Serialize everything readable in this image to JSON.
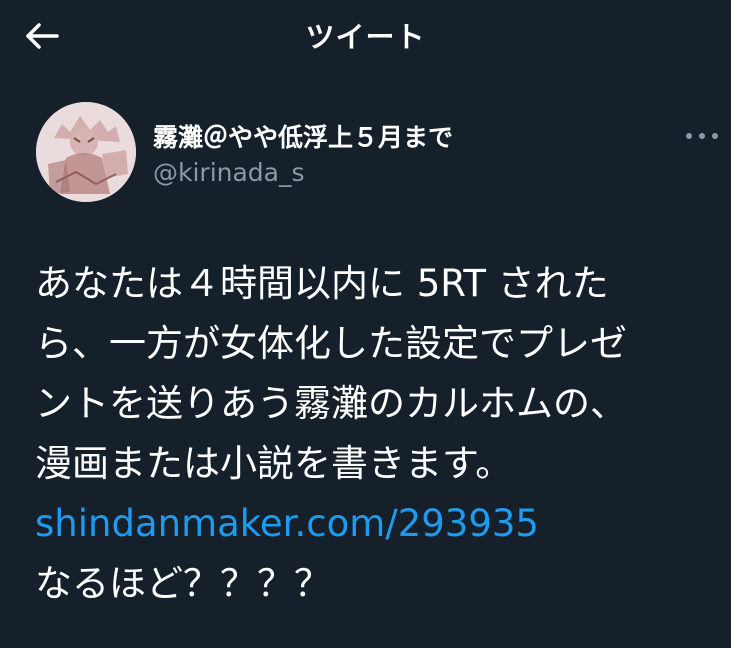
{
  "header": {
    "title": "ツイート",
    "back_icon": "arrow-left-icon"
  },
  "tweet": {
    "author": {
      "display_name": "霧灘＠やや低浮上５月まで",
      "handle": "@kirinada_s",
      "avatar": "avatar-image"
    },
    "more_icon": "more-horizontal-icon",
    "text_lines": [
      "あなたは４時間以内に 5RT された",
      "ら、一方が女体化した設定でプレゼ",
      "ントを送りあう霧灘のカルホムの、",
      "漫画または小説を書きます。"
    ],
    "link": "shindanmaker.com/293935",
    "closing": "なるほど？？？？"
  },
  "colors": {
    "background": "#15202b",
    "text": "#ffffff",
    "secondary_text": "#8b98a5",
    "link": "#1d9bf0"
  }
}
